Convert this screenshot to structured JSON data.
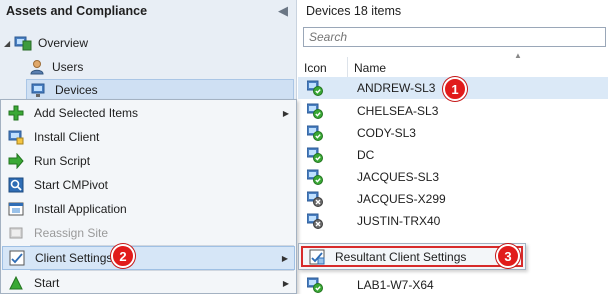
{
  "nav": {
    "title": "Assets and Compliance",
    "collapse_glyph": "◀",
    "tree": [
      {
        "label": "Overview",
        "icon": "overview-icon"
      },
      {
        "label": "Users",
        "icon": "user-icon"
      },
      {
        "label": "Devices",
        "icon": "devices-icon"
      }
    ]
  },
  "content": {
    "title": "Devices 18 items",
    "search_placeholder": "Search",
    "columns": {
      "icon": "Icon",
      "name": "Name"
    },
    "rows": [
      {
        "name": "ANDREW-SL3",
        "icon": "device-ok-icon"
      },
      {
        "name": "CHELSEA-SL3",
        "icon": "device-ok-icon"
      },
      {
        "name": "CODY-SL3",
        "icon": "device-ok-icon"
      },
      {
        "name": "DC",
        "icon": "device-ok-icon"
      },
      {
        "name": "JACQUES-SL3",
        "icon": "device-ok-icon"
      },
      {
        "name": "JACQUES-X299",
        "icon": "device-error-icon"
      },
      {
        "name": "JUSTIN-TRX40",
        "icon": "device-error-icon"
      },
      {
        "name": "LAB1-W7-X64",
        "icon": "device-ok-icon"
      }
    ]
  },
  "context_menu": {
    "items": [
      {
        "label": "Add Selected Items",
        "icon": "add-icon",
        "has_submenu": true
      },
      {
        "label": "Install Client",
        "icon": "install-client-icon"
      },
      {
        "label": "Run Script",
        "icon": "run-script-icon"
      },
      {
        "label": "Start CMPivot",
        "icon": "cmpivot-icon"
      },
      {
        "label": "Install Application",
        "icon": "install-application-icon"
      },
      {
        "label": "Reassign Site",
        "icon": "reassign-site-icon",
        "disabled": true
      },
      {
        "label": "Client Settings",
        "icon": "client-settings-icon",
        "has_submenu": true,
        "highlighted": true
      },
      {
        "label": "Start",
        "icon": "start-icon",
        "has_submenu": true
      }
    ]
  },
  "submenu": {
    "items": [
      {
        "label": "Resultant Client Settings",
        "icon": "resultant-settings-icon"
      }
    ]
  },
  "callouts": [
    "1",
    "2",
    "3"
  ],
  "colors": {
    "callout": "#e11b1b",
    "highlight_border": "#d72b2b",
    "selection": "#d6e6f7",
    "nav_bg": "#e8eef5"
  }
}
